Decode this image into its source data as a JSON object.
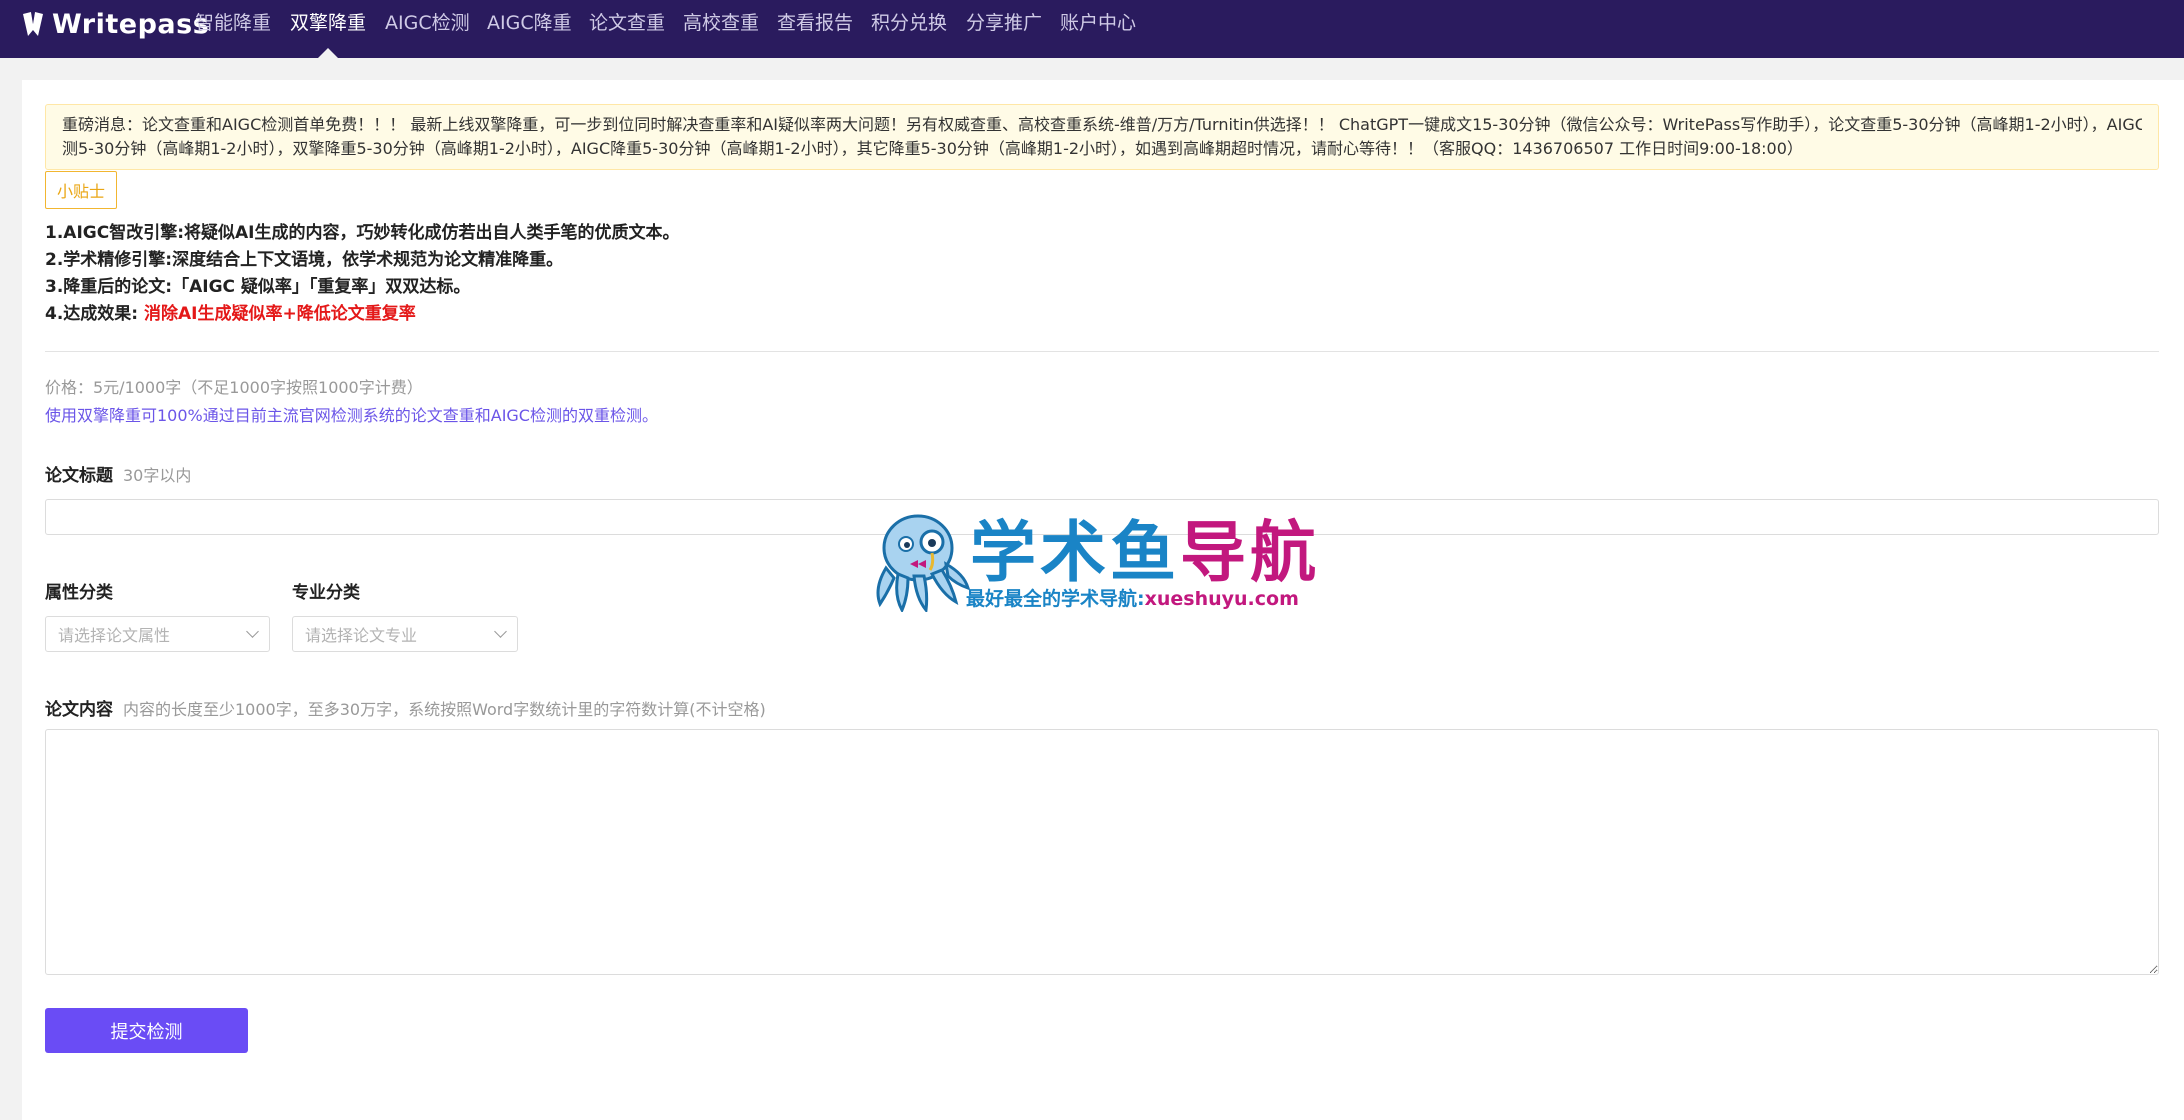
{
  "brand": {
    "name": "Writepass"
  },
  "nav": [
    {
      "label": "智能降重",
      "active": false
    },
    {
      "label": "双擎降重",
      "active": true
    },
    {
      "label": "AIGC检测",
      "active": false
    },
    {
      "label": "AIGC降重",
      "active": false
    },
    {
      "label": "论文查重",
      "active": false
    },
    {
      "label": "高校查重",
      "active": false
    },
    {
      "label": "查看报告",
      "active": false
    },
    {
      "label": "积分兑换",
      "active": false
    },
    {
      "label": "分享推广",
      "active": false
    },
    {
      "label": "账户中心",
      "active": false
    }
  ],
  "notice": {
    "line1": "重磅消息：论文查重和AIGC检测首单免费！！！ 最新上线双擎降重，可一步到位同时解决查重率和AI疑似率两大问题！另有权威查重、高校查重系统-维普/万方/Turnitin供选择！！ ChatGPT一键成文15-30分钟（微信公众号：WritePass写作助手），论文查重5-30分钟（高峰期1-2小时），AIGC检",
    "line2": "测5-30分钟（高峰期1-2小时），双擎降重5-30分钟（高峰期1-2小时），AIGC降重5-30分钟（高峰期1-2小时），其它降重5-30分钟（高峰期1-2小时），如遇到高峰期超时情况，请耐心等待！！（客服QQ：1436706507 工作日时间9:00-18:00）"
  },
  "tips": {
    "tag": "小贴士",
    "item1": "1.AIGC智改引擎:将疑似AI生成的内容，巧妙转化成仿若出自人类手笔的优质文本。",
    "item2": "2.学术精修引擎:深度结合上下文语境，依学术规范为论文精准降重。",
    "item3": "3.降重后的论文:「AIGC 疑似率」「重复率」双双达标。",
    "item4_prefix": "4.达成效果:",
    "item4_highlight": "消除AI生成疑似率+降低论文重复率"
  },
  "pricing": {
    "price": "价格：5元/1000字（不足1000字按照1000字计费）",
    "guarantee": "使用双擎降重可100%通过目前主流官网检测系统的论文查重和AIGC检测的双重检测。"
  },
  "form": {
    "title_label": "论文标题",
    "title_hint": "30字以内",
    "title_value": "",
    "attr_label": "属性分类",
    "attr_placeholder": "请选择论文属性",
    "major_label": "专业分类",
    "major_placeholder": "请选择论文专业",
    "content_label": "论文内容",
    "content_hint": "内容的长度至少1000字，至多30万字，系统按照Word字数统计里的字符数计算(不计空格)",
    "content_value": "",
    "submit_label": "提交检测"
  },
  "watermark": {
    "title_part1": "学术鱼",
    "title_part2": "导航",
    "subtitle_part1": "最好最全的学术导航:",
    "subtitle_part2": "xueshuyu.com"
  },
  "colors": {
    "topbar": "#2a1b5e",
    "accent": "#6a4cf5",
    "notice_bg": "#fffbe6",
    "tip_tag": "#f2b630",
    "highlight_red": "#e41818",
    "link_purple": "#6b55e8"
  }
}
